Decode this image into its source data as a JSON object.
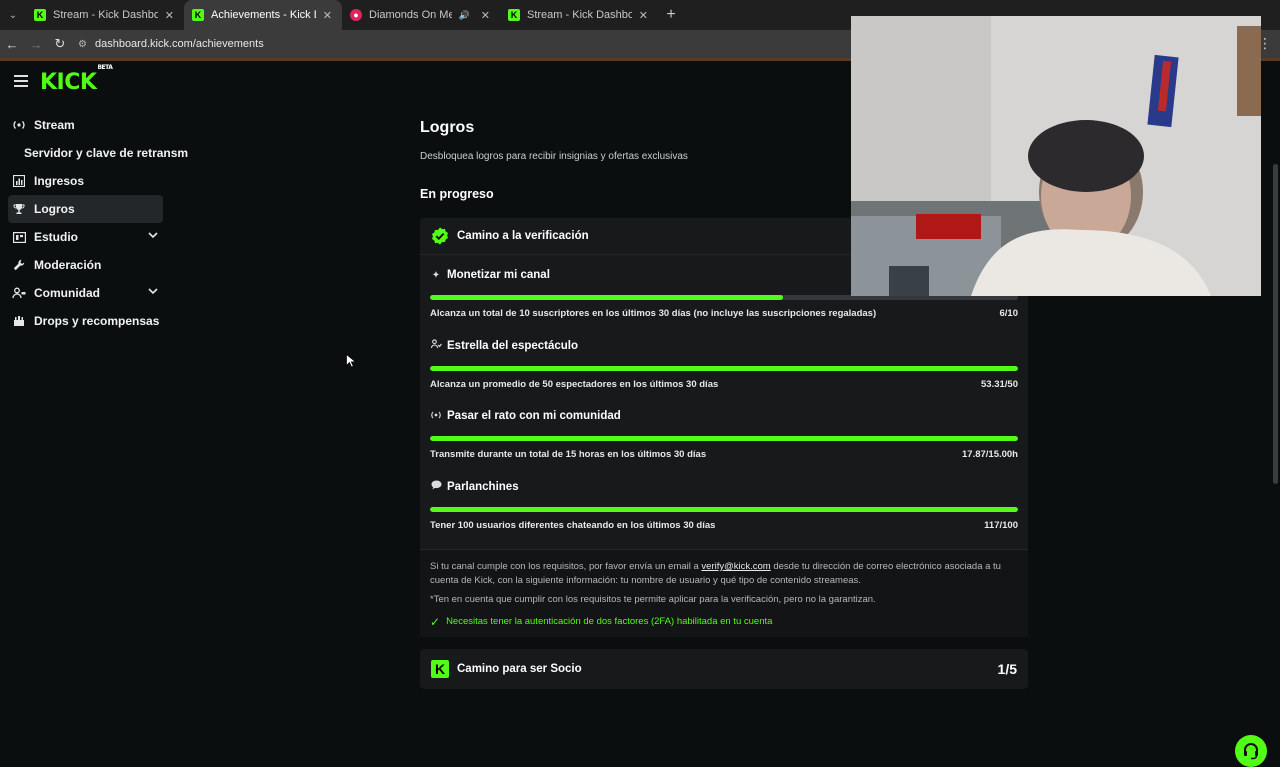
{
  "browser": {
    "tabs": [
      {
        "title": "Stream - Kick Dashboard",
        "active": false
      },
      {
        "title": "Achievements - Kick Dashboard",
        "active": true
      },
      {
        "title": "Diamonds On Me (con Lil T",
        "active": false
      },
      {
        "title": "Stream - Kick Dashboard",
        "active": false
      }
    ],
    "url": "dashboard.kick.com/achievements"
  },
  "brand": {
    "logo": "KICK",
    "logo_badge": "BETA",
    "accent": "#53fc18"
  },
  "sidebar": {
    "items": [
      {
        "label": "Stream",
        "icon": "broadcast-icon"
      },
      {
        "label": "Servidor y clave de retransm",
        "icon": ""
      },
      {
        "label": "Ingresos",
        "icon": "chart-icon"
      },
      {
        "label": "Logros",
        "icon": "trophy-icon"
      },
      {
        "label": "Estudio",
        "icon": "studio-icon"
      },
      {
        "label": "Moderación",
        "icon": "wrench-icon"
      },
      {
        "label": "Comunidad",
        "icon": "community-icon"
      },
      {
        "label": "Drops y recompensas",
        "icon": "gift-icon"
      }
    ]
  },
  "main": {
    "title": "Logros",
    "subtitle": "Desbloquea logros para recibir insignias y ofertas exclusivas",
    "section": "En progreso",
    "card1": {
      "title": "Camino a la verificación",
      "goals": [
        {
          "title": "Monetizar mi canal",
          "icon": "sparkle-icon",
          "desc": "Alcanza un total de 10 suscriptores en los últimos 30 días (no incluye las suscripciones regaladas)",
          "value": "6/10",
          "progress": 0.6
        },
        {
          "title": "Estrella del espectáculo",
          "icon": "users-icon",
          "desc": "Alcanza un promedio de 50 espectadores en los últimos 30 días",
          "value": "53.31/50",
          "progress": 1.0
        },
        {
          "title": "Pasar el rato con mi comunidad",
          "icon": "broadcast-icon",
          "desc": "Transmite durante un total de 15 horas en los últimos 30 días",
          "value": "17.87/15.00h",
          "progress": 1.0
        },
        {
          "title": "Parlanchines",
          "icon": "chat-icon",
          "desc": "Tener 100 usuarios diferentes chateando en los últimos 30 días",
          "value": "117/100",
          "progress": 1.0
        }
      ],
      "footer": {
        "text_before": "Si tu canal cumple con los requisitos, por favor envía un email a ",
        "email": "verify@kick.com",
        "text_after": " desde tu dirección de correo electrónico asociada a tu cuenta de Kick, con la siguiente información: tu nombre de usuario y qué tipo de contenido streameas.",
        "note": "*Ten en cuenta que cumplir con los requisitos te permite aplicar para la verificación, pero no la garantizan.",
        "requirement": "Necesitas tener la autenticación de dos factores (2FA) habilitada en tu cuenta"
      }
    },
    "card2": {
      "title": "Camino para ser Socio",
      "count": "1/5"
    }
  }
}
